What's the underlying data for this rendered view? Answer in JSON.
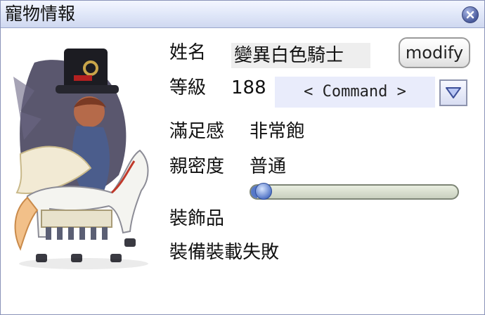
{
  "window": {
    "title": "寵物情報"
  },
  "pet": {
    "name_label": "姓名",
    "name": "變異白色騎士",
    "modify_label": "modify",
    "level_label": "等級",
    "level": "188",
    "command_label": "< Command >",
    "satiety_label": "滿足感",
    "satiety": "非常飽",
    "intimacy_label": "親密度",
    "intimacy": "普通",
    "intimacy_progress": 0.03,
    "accessory_label": "裝飾品",
    "accessory_status": "裝備裝載失敗"
  },
  "colors": {
    "title_bar": "#dfe6f8",
    "command_bg": "#e9ecfb",
    "bar_track": "#c9d0bf",
    "bar_fill": "#5678c8"
  },
  "icons": {
    "close": "close-icon",
    "dropdown": "chevron-down-icon"
  }
}
